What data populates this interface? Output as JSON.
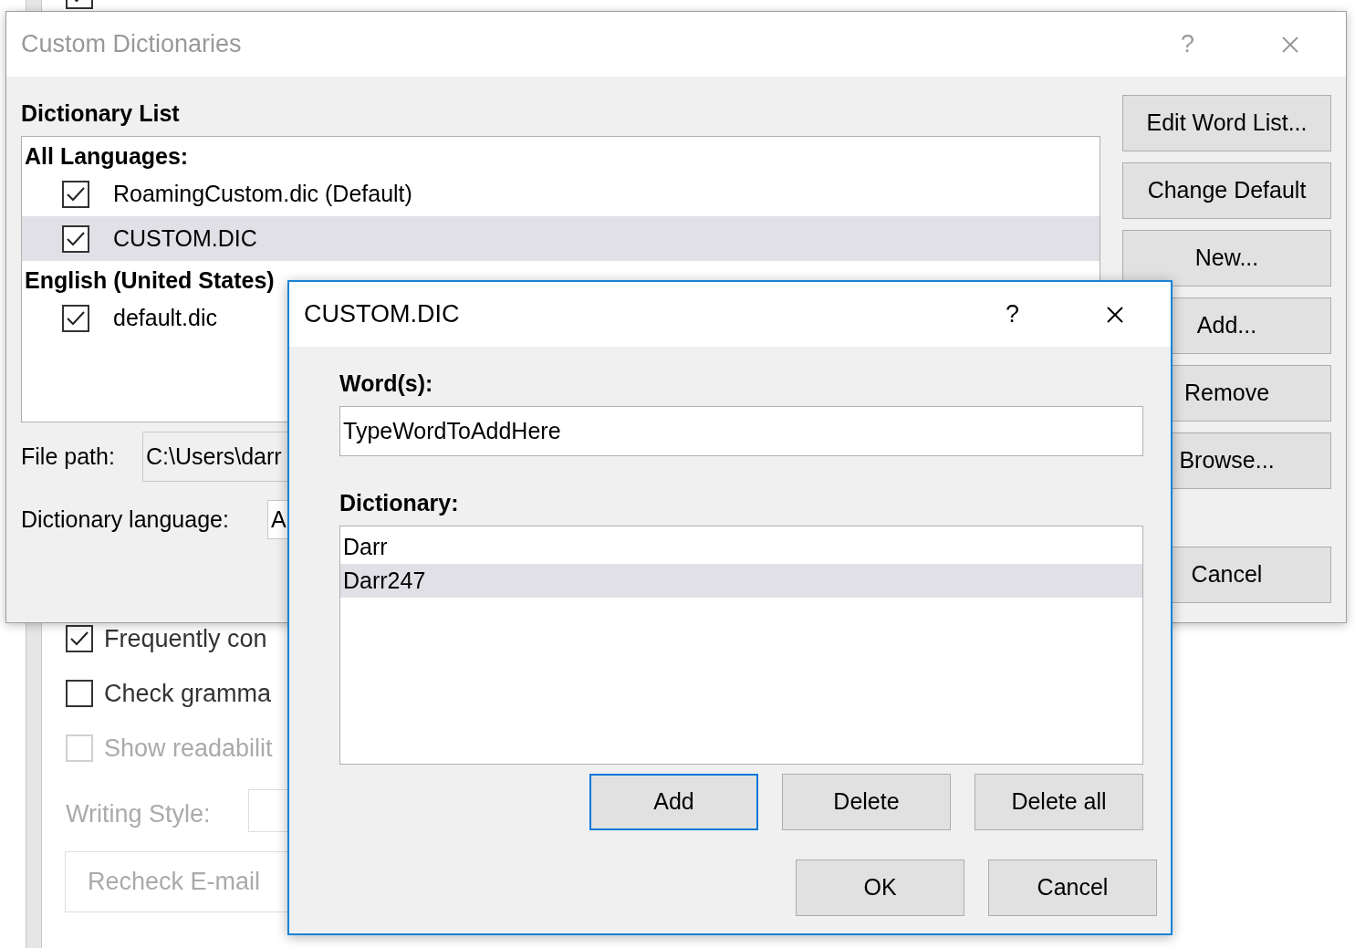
{
  "options_window": {
    "top_option": {
      "checked": true
    },
    "options": [
      {
        "label": "Frequently con",
        "checked": true,
        "disabled": false
      },
      {
        "label": "Check gramma",
        "checked": false,
        "disabled": false
      },
      {
        "label": "Show readabilit",
        "checked": false,
        "disabled": true
      }
    ],
    "writing_style": {
      "label": "Writing Style:",
      "disabled": true
    },
    "recheck_button": {
      "label": "Recheck E-mail",
      "disabled": true
    }
  },
  "custom_dictionaries": {
    "title": "Custom Dictionaries",
    "active": false,
    "help": "?",
    "dictionary_list": {
      "label": "Dictionary List",
      "groups": [
        {
          "name": "All Languages:",
          "items": [
            {
              "name": "RoamingCustom.dic (Default)",
              "checked": true,
              "selected": false
            },
            {
              "name": "CUSTOM.DIC",
              "checked": true,
              "selected": true
            }
          ]
        },
        {
          "name": "English (United States)",
          "items": [
            {
              "name": "default.dic",
              "checked": true,
              "selected": false
            }
          ]
        }
      ]
    },
    "file_path": {
      "label": "File path:",
      "value": "C:\\Users\\darr"
    },
    "language": {
      "label": "Dictionary language:",
      "value": "A"
    },
    "buttons": [
      "Edit Word List...",
      "Change Default",
      "New...",
      "Add...",
      "Remove",
      "Browse..."
    ],
    "cancel": "Cancel"
  },
  "word_dialog": {
    "title": "CUSTOM.DIC",
    "active": true,
    "help": "?",
    "words_label": "Word(s):",
    "words_value": "TypeWordToAddHere",
    "dictionary_label": "Dictionary:",
    "entries": [
      {
        "text": "Darr",
        "selected": false
      },
      {
        "text": "Darr247",
        "selected": true
      }
    ],
    "buttons": [
      {
        "label": "Add",
        "default": true
      },
      {
        "label": "Delete",
        "default": false
      },
      {
        "label": "Delete all",
        "default": false
      }
    ],
    "footer_buttons": [
      "OK",
      "Cancel"
    ]
  }
}
